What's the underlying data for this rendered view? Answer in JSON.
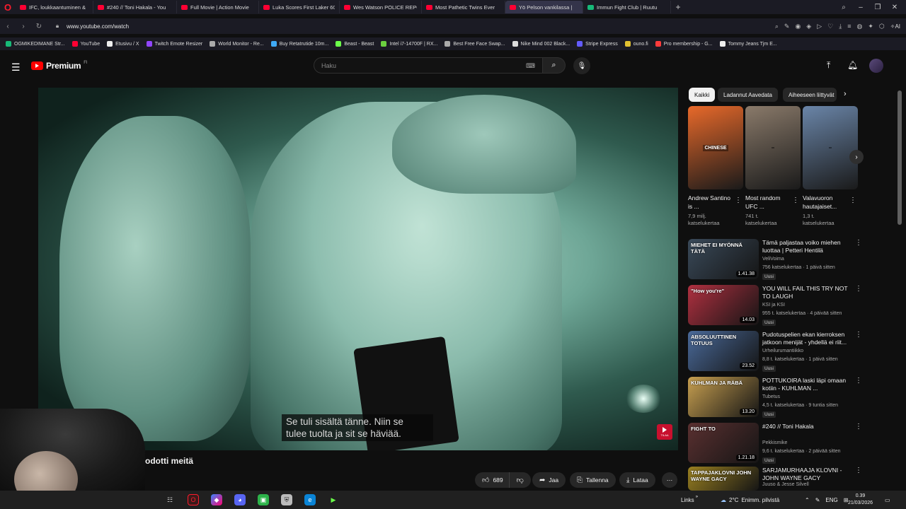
{
  "browser": {
    "tabs": [
      {
        "label": "IFC, loukkaantuminen &",
        "active": false
      },
      {
        "label": "#240 // Toni Hakala - You",
        "active": false
      },
      {
        "label": "Full Movie | Action Movie",
        "active": false
      },
      {
        "label": "Luka Scores First Laker 60",
        "active": false
      },
      {
        "label": "Wes Watson POLICE REPO",
        "active": false
      },
      {
        "label": "Most Pathetic Twins Ever",
        "active": false
      },
      {
        "label": "Yö Pelson vankilassa |",
        "active": true
      },
      {
        "label": "Immun Fight Club | Ruutu",
        "active": false
      }
    ],
    "url": "www.youtube.com/watch",
    "ai_label": "AI",
    "bookmarks": [
      "OGMIKEDIMANE Str...",
      "YouTube",
      "Etusivu / X",
      "Twitch Emote Resizer",
      "World Monitor - Re...",
      "Buy Retatrutide 10m...",
      "Beast - Beast",
      "Intel i7-14700F | RX...",
      "Best Free Face Swap...",
      "Nike Mind 002 Black...",
      "Stripe Express",
      "ouno.fi",
      "Pro membership - G...",
      "Tommy Jeans Tjm E..."
    ]
  },
  "youtube": {
    "logo_text": "Premium",
    "logo_sup": "FI",
    "search_placeholder": "Haku",
    "icons": [
      "menu-icon",
      "keyboard-icon",
      "search-icon",
      "mic-icon",
      "create-icon",
      "bell-icon"
    ]
  },
  "video": {
    "subtitle_line1": "Se tuli sisältä tänne. Niin se",
    "subtitle_line2": "tulee tuolta ja sit se häviää.",
    "watermark_text": "TILAA",
    "title_partial": "odotti meitä",
    "actions": {
      "likes": "689",
      "share": "Jaa",
      "save": "Tallenna",
      "download": "Lataa"
    }
  },
  "sidebar": {
    "chips": [
      "Kaikki",
      "Ladannut Aavedata",
      "Aiheeseen liittyvät"
    ],
    "shorts": [
      {
        "title": "Andrew Santino is ...",
        "views": "7,9 milj.",
        "views_label": "katselukertaa",
        "thumb_text": "CHINESE",
        "color": "#e8692a"
      },
      {
        "title": "Most random UFC ...",
        "views": "741 t.",
        "views_label": "katselukertaa",
        "thumb_text": "",
        "color": "#8a7a6a"
      },
      {
        "title": "Valavuoron hautajaiset...",
        "views": "1,3 t.",
        "views_label": "katselukertaa",
        "thumb_text": "",
        "color": "#6a85a8"
      }
    ],
    "recommendations": [
      {
        "title": "Tämä paljastaa voiko miehen luottaa | Petteri Hentilä",
        "channel": "VeliVoima",
        "meta": "756 katselukertaa · 1 päivä sitten",
        "badge": "Uusi",
        "duration": "1.41.38",
        "thumb_text": "MIEHET EI MYÖNNÄ TÄTÄ",
        "color": "#3a4a5a"
      },
      {
        "title": "YOU WILL FAIL THIS TRY NOT TO LAUGH",
        "channel": "KSI ja KSI",
        "meta": "955 t. katselukertaa · 4 päivää sitten",
        "badge": "Uusi",
        "duration": "14.03",
        "thumb_text": "\"How you're\"",
        "color": "#b03040"
      },
      {
        "title": "Pudotuspelien ekan kierroksen jatkoon menijät - yhdellä ei riit...",
        "channel": "Urheilurumantiikko",
        "meta": "8,8 t. katselukertaa · 1 päivä sitten",
        "badge": "Uusi",
        "duration": "23.52",
        "thumb_text": "ABSOLUUTTINEN TOTUUS",
        "color": "#4a6a9a"
      },
      {
        "title": "POTTUKOIRA laski läpi omaan kotiin - KUHLMAN ...",
        "channel": "Tubetus",
        "meta": "4,5 t. katselukertaa · 9 tuntia sitten",
        "badge": "Uusi",
        "duration": "13.20",
        "thumb_text": "KUHLMAN JA RÄBÄ",
        "color": "#c8a050"
      },
      {
        "title": "#240 // Toni Hakala",
        "channel": "Pekkismike",
        "meta": "9,6 t. katselukertaa · 2 päivää sitten",
        "badge": "Uusi",
        "duration": "1.21.18",
        "thumb_text": "FIGHT TO",
        "color": "#5a3030"
      },
      {
        "title": "SARJAMURHAAJA KLOVNI - JOHN WAYNE GACY",
        "channel": "Juuso & Jesse Silvell",
        "meta": "",
        "badge": "",
        "duration": "",
        "thumb_text": "TAPPAJAKLOVNI JOHN WAYNE GACY",
        "color": "#9a8020"
      }
    ]
  },
  "taskbar": {
    "links_label": "Links",
    "weather": "2°C",
    "weather_desc": "Enimm. pilvistä",
    "lang": "ENG",
    "time": "0.39",
    "date": "21/03/2026"
  },
  "colors": {
    "background": "#0f0f0f",
    "yt_red": "#ff0000",
    "chip_active": "#f1f1f1",
    "pill": "#272727"
  }
}
